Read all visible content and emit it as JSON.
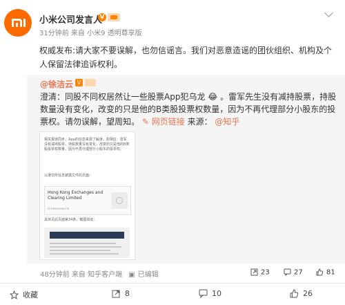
{
  "post": {
    "author": "小米公司发言人",
    "v_badge": "V",
    "meta": "31分钟前 来自 小米9 透明尊享版",
    "text": "权威发布:请大家不要误解，也勿信谣言。我们对恶意造谣的团伙组织、机构及个人保留法律追诉权利。"
  },
  "repost": {
    "author": "@徐洁云",
    "v_badge": "V",
    "text_a": "澄清：同股不同权居然让一些股票App犯乌龙",
    "text_b": "。雷军先生没有减持股票，持股数量没有变化，改变的只是他的B类股投票权数量，因为不再代理部分小股东的投票权。请勿误解，望周知。",
    "link_label": "网页链接",
    "source_label": "来源：",
    "source": "@知乎",
    "thumb": {
      "intro": "相关报道同步，App的信息来源了解误，而相应：雷军没有减持股票，持股数量没有变化，改变的只是他的B类股投票权数量，因为不再代理部分小股东的投票权。",
      "query": "以港交所信息披露文件的页面：",
      "card_title": "Hong Kong Exchanges and Clearing Limited",
      "card_sub": "m.hkexnews.hk",
      "page_note": "具体见此页面第34条，截图如此："
    },
    "meta": "48分钟前 来自 知乎客户端",
    "edited": "已编辑",
    "reposts": "23",
    "comments": "27",
    "likes": "81"
  },
  "actions": {
    "collect": "收藏",
    "repost": "8",
    "comment": "10",
    "like": "26"
  },
  "colors": {
    "accent": "#ff8200",
    "link": "#eb7350",
    "mi_orange": "#ff6900"
  }
}
